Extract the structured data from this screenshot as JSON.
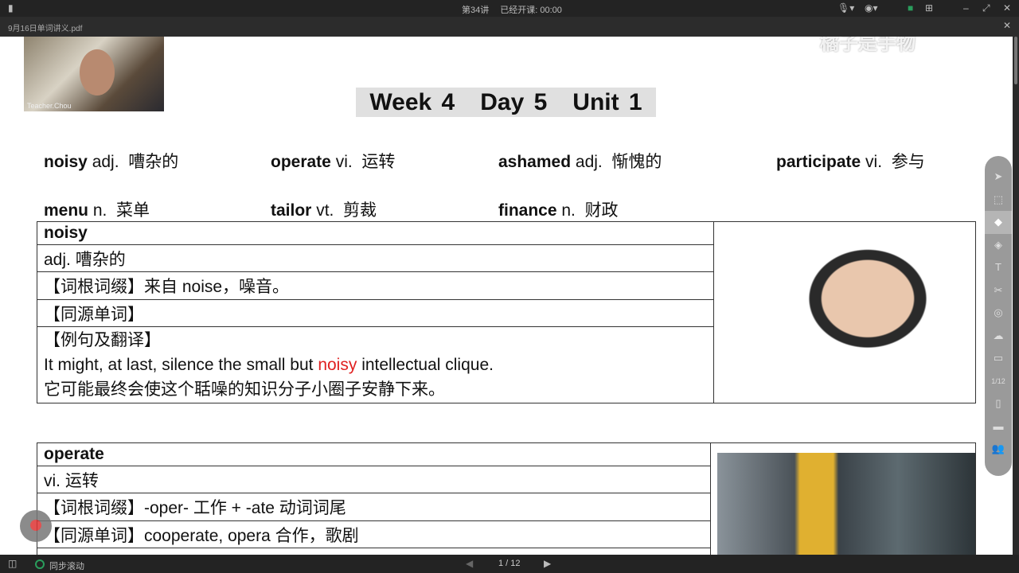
{
  "topbar": {
    "lesson": "第34讲",
    "elapsed": "已经开课: 00:00"
  },
  "tab": {
    "filename": "9月16日单词讲义.pdf"
  },
  "webcam": {
    "name": "Teacher.Chou"
  },
  "watermark": "橘子是手物",
  "title": {
    "week": "Week 4",
    "day": "Day 5",
    "unit": "Unit 1"
  },
  "words": [
    {
      "word": "noisy",
      "pos": "adj.",
      "meaning": "嘈杂的"
    },
    {
      "word": "operate",
      "pos": "vi.",
      "meaning": "运转"
    },
    {
      "word": "ashamed",
      "pos": "adj.",
      "meaning": "惭愧的"
    },
    {
      "word": "participate",
      "pos": "vi.",
      "meaning": "参与"
    },
    {
      "word": "menu",
      "pos": "n.",
      "meaning": "菜单"
    },
    {
      "word": "tailor",
      "pos": "vt.",
      "meaning": "剪裁"
    },
    {
      "word": "finance",
      "pos": "n.",
      "meaning": "财政"
    }
  ],
  "card1": {
    "word": "noisy",
    "def": "adj.  嘈杂的",
    "root": "【词根词缀】来自  noise，噪音。",
    "cognate": "【同源单词】",
    "example_head": "【例句及翻译】",
    "ex_pre": "It might, at last, silence the small but ",
    "ex_hl": "noisy",
    "ex_post": " intellectual clique.",
    "translation": "它可能最终会使这个聒噪的知识分子小圈子安静下来。"
  },
  "card2": {
    "word": "operate",
    "def": "vi.  运转",
    "root": "【词根词缀】-oper-  工作  + -ate  动词词尾",
    "cognate": "【同源单词】cooperate, opera        合作，歌剧"
  },
  "bottombar": {
    "sync": "同步滚动",
    "page": "1 / 12"
  },
  "colors": {
    "highlight": "#e02020",
    "titlebg": "#e0e0e0"
  }
}
